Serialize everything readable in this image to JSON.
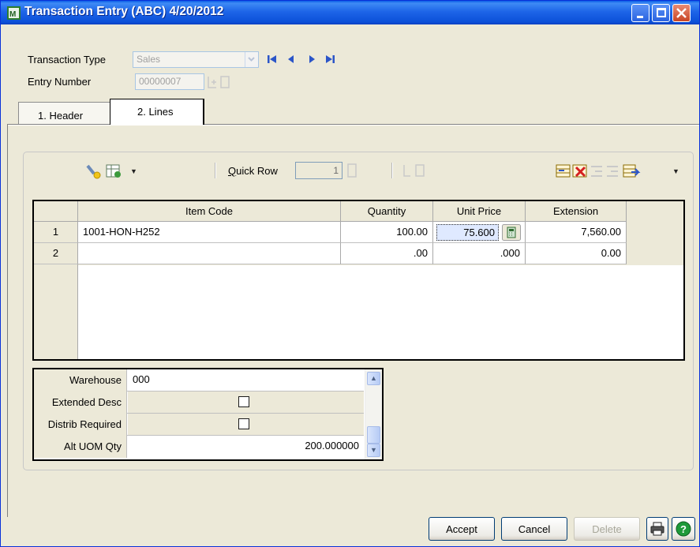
{
  "window": {
    "title": "Transaction Entry (ABC) 4/20/2012",
    "app_icon": "sage-mas-icon",
    "controls": [
      "minimize-icon",
      "maximize-icon",
      "close-icon"
    ]
  },
  "header": {
    "transaction_type_label": "Transaction Type",
    "transaction_type_value": "Sales",
    "entry_number_label": "Entry Number",
    "entry_number_value": "00000007"
  },
  "tabs": [
    {
      "label": "1. Header",
      "active": false
    },
    {
      "label": "2. Lines",
      "active": true
    }
  ],
  "lines_toolbar": {
    "quick_row_label": "Quick Row",
    "quick_row_value": "1"
  },
  "grid": {
    "columns": [
      "Item Code",
      "Quantity",
      "Unit Price",
      "Extension"
    ],
    "rows": [
      {
        "num": "1",
        "item_code": "1001-HON-H252",
        "quantity": "100.00",
        "unit_price": "75.600",
        "extension": "7,560.00"
      },
      {
        "num": "2",
        "item_code": "",
        "quantity": ".00",
        "unit_price": ".000",
        "extension": "0.00"
      }
    ]
  },
  "properties": [
    {
      "label": "Warehouse",
      "value": "000",
      "type": "text"
    },
    {
      "label": "Extended Desc",
      "value": "",
      "type": "checkbox",
      "checked": false
    },
    {
      "label": "Distrib Required",
      "value": "",
      "type": "checkbox",
      "checked": false
    },
    {
      "label": "Alt UOM Qty",
      "value": "200.000000",
      "type": "number"
    }
  ],
  "buttons": {
    "accept": "Accept",
    "cancel": "Cancel",
    "delete": "Delete"
  },
  "colors": {
    "titlebar": "#0b50d8",
    "selected_cell": "#dfe9ff"
  }
}
